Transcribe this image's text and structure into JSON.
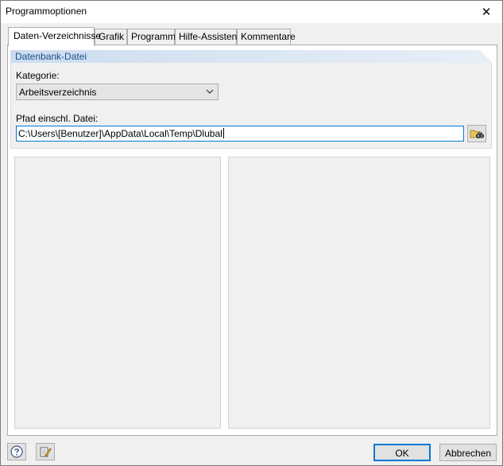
{
  "window": {
    "title": "Programmoptionen",
    "close_symbol": "✕"
  },
  "tabs": [
    {
      "label": "Daten-Verzeichnisse",
      "active": true
    },
    {
      "label": "Grafik",
      "active": false
    },
    {
      "label": "Programm",
      "active": false
    },
    {
      "label": "Hilfe-Assistent",
      "active": false
    },
    {
      "label": "Kommentare",
      "active": false
    }
  ],
  "database_group": {
    "title": "Datenbank-Datei",
    "category_label": "Kategorie:",
    "category_value": "Arbeitsverzeichnis",
    "path_label": "Pfad einschl. Datei:",
    "path_value": "C:\\Users\\[Benutzer]\\AppData\\Local\\Temp\\Dlubal",
    "browse_icon": "folder-binoculars-icon"
  },
  "footer": {
    "help_icon": "help-icon",
    "edit_icon": "edit-notes-icon",
    "ok_label": "OK",
    "cancel_label": "Abbrechen"
  },
  "colors": {
    "accent": "#0078d7",
    "group_title": "#1b4f8f",
    "group_header": "#ccdcee"
  }
}
